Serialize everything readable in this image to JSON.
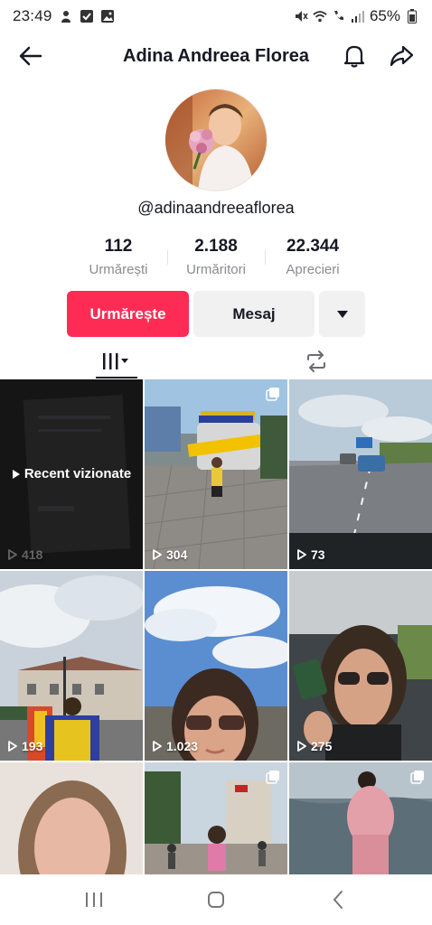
{
  "status_bar": {
    "time": "23:49",
    "battery": "65%"
  },
  "header": {
    "title": "Adina Andreea Florea"
  },
  "profile": {
    "username": "@adinaandreeaflorea",
    "stats": [
      {
        "value": "112",
        "label": "Urmărești"
      },
      {
        "value": "2.188",
        "label": "Urmăritori"
      },
      {
        "value": "22.344",
        "label": "Aprecieri"
      }
    ]
  },
  "actions": {
    "follow_label": "Urmărește",
    "message_label": "Mesaj"
  },
  "colors": {
    "accent": "#fe2c55",
    "secondary_bg": "#f1f1f2"
  },
  "grid": {
    "recent_label": "Recent vizionate",
    "videos": [
      {
        "views": "418"
      },
      {
        "views": "304"
      },
      {
        "views": "73"
      },
      {
        "views": "193"
      },
      {
        "views": "1.023"
      },
      {
        "views": "275"
      },
      {
        "views": ""
      },
      {
        "views": ""
      },
      {
        "views": ""
      }
    ]
  },
  "icons": {
    "header": [
      "back-arrow-icon",
      "bell-icon",
      "share-icon"
    ],
    "tabs": [
      "videos-grid-icon",
      "repost-icon"
    ],
    "nav": [
      "recent-apps-icon",
      "home-icon",
      "back-icon"
    ]
  }
}
